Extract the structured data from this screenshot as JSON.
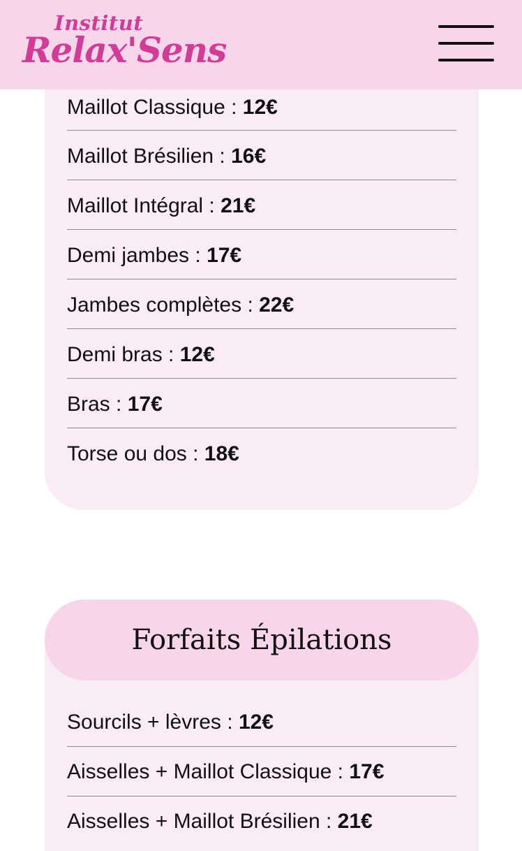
{
  "header": {
    "logo_top": "Institut",
    "logo_main": "Relax'Sens",
    "menu_icon": "hamburger-menu-icon"
  },
  "colors": {
    "header_bg": "#f8d6ea",
    "card_bg": "#f9ecf3",
    "logo": "#d23c96"
  },
  "epilations": {
    "items": [
      {
        "label": "Maillot Classique :",
        "price": "12€"
      },
      {
        "label": "Maillot Brésilien :",
        "price": "16€"
      },
      {
        "label": "Maillot Intégral :",
        "price": "21€"
      },
      {
        "label": "Demi jambes :",
        "price": "17€"
      },
      {
        "label": "Jambes complètes :",
        "price": "22€"
      },
      {
        "label": "Demi bras :",
        "price": "12€"
      },
      {
        "label": "Bras :",
        "price": "17€"
      },
      {
        "label": "Torse ou dos :",
        "price": "18€"
      }
    ]
  },
  "forfaits": {
    "title": "Forfaits Épilations",
    "items": [
      {
        "label": "Sourcils + lèvres :",
        "price": "12€"
      },
      {
        "label": "Aisselles + Maillot Classique :",
        "price": "17€"
      },
      {
        "label": "Aisselles + Maillot Brésilien :",
        "price": "21€"
      }
    ]
  }
}
